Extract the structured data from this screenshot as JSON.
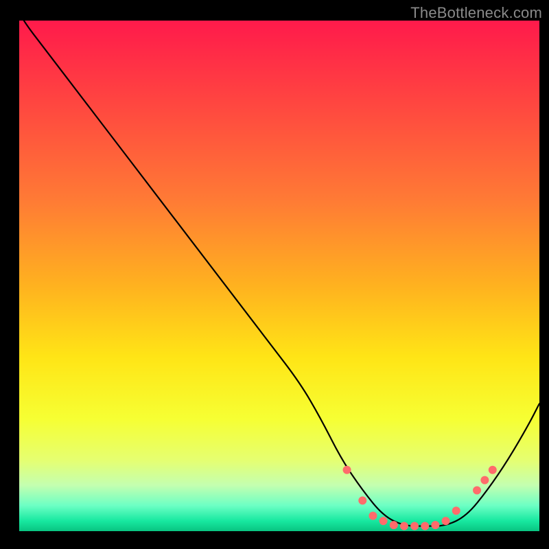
{
  "watermark": "TheBottleneck.com",
  "chart_data": {
    "type": "line",
    "title": "",
    "xlabel": "",
    "ylabel": "",
    "xlim": [
      0,
      100
    ],
    "ylim": [
      0,
      100
    ],
    "background_gradient": {
      "stops": [
        {
          "offset": 0,
          "color": "#ff1a4b"
        },
        {
          "offset": 18,
          "color": "#ff4b3f"
        },
        {
          "offset": 35,
          "color": "#ff7a35"
        },
        {
          "offset": 52,
          "color": "#ffb21f"
        },
        {
          "offset": 66,
          "color": "#ffe516"
        },
        {
          "offset": 78,
          "color": "#f6ff33"
        },
        {
          "offset": 86,
          "color": "#e6ff70"
        },
        {
          "offset": 91,
          "color": "#c4ffb0"
        },
        {
          "offset": 95,
          "color": "#6cffc4"
        },
        {
          "offset": 98,
          "color": "#17e8a0"
        },
        {
          "offset": 100,
          "color": "#09c481"
        }
      ]
    },
    "series": [
      {
        "name": "bottleneck-curve",
        "color": "#000000",
        "x": [
          0,
          6,
          12,
          18,
          24,
          30,
          36,
          42,
          48,
          54,
          58,
          62,
          66,
          70,
          74,
          78,
          82,
          86,
          90,
          94,
          98,
          100
        ],
        "y": [
          101,
          93,
          85,
          77,
          69,
          61,
          53,
          45,
          37,
          29,
          22,
          14,
          8,
          3,
          1,
          1,
          1,
          3,
          8,
          14,
          21,
          25
        ]
      }
    ],
    "markers": {
      "name": "highlight-points",
      "color": "#ff6b6b",
      "points": [
        {
          "x": 63,
          "y": 12
        },
        {
          "x": 66,
          "y": 6
        },
        {
          "x": 68,
          "y": 3
        },
        {
          "x": 70,
          "y": 2
        },
        {
          "x": 72,
          "y": 1.2
        },
        {
          "x": 74,
          "y": 1
        },
        {
          "x": 76,
          "y": 1
        },
        {
          "x": 78,
          "y": 1
        },
        {
          "x": 80,
          "y": 1.2
        },
        {
          "x": 82,
          "y": 2
        },
        {
          "x": 84,
          "y": 4
        },
        {
          "x": 88,
          "y": 8
        },
        {
          "x": 89.5,
          "y": 10
        },
        {
          "x": 91,
          "y": 12
        }
      ]
    }
  }
}
